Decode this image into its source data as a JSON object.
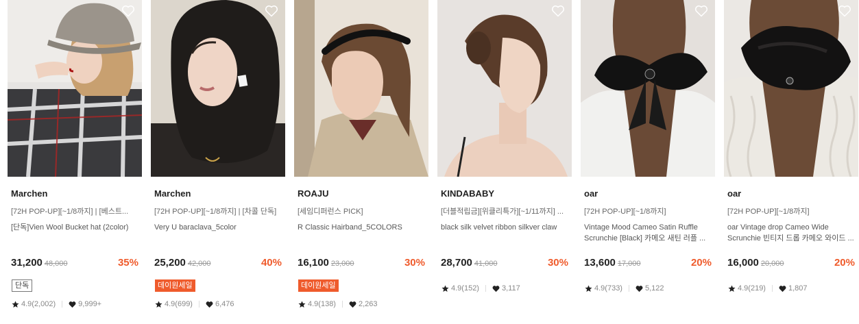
{
  "products": [
    {
      "brand": "Marchen",
      "line1": "[72H POP-UP][~1/8까지] | [베스트...",
      "desc": "[단독]Vien Wool Bucket hat (2color)",
      "price": "31,200",
      "original_price": "48,000",
      "discount": "35%",
      "badge": "단독",
      "badge_style": "outline",
      "rating": "4.9(2,002)",
      "likes": "9,999+",
      "heart_icon": "heart-outline-icon"
    },
    {
      "brand": "Marchen",
      "line1": "[72H POP-UP][~1/8까지] | [차콜 단독]",
      "desc": "Very U baraclava_5color",
      "price": "25,200",
      "original_price": "42,000",
      "discount": "40%",
      "badge": "데이원세일",
      "badge_style": "solid",
      "rating": "4.9(699)",
      "likes": "6,476",
      "heart_icon": "heart-outline-icon"
    },
    {
      "brand": "ROAJU",
      "line1": "[세임디퍼런스 PICK]",
      "desc": "R Classic Hairband_5COLORS",
      "price": "16,100",
      "original_price": "23,000",
      "discount": "30%",
      "badge": "데이원세일",
      "badge_style": "solid",
      "rating": "4.9(138)",
      "likes": "2,263",
      "heart_icon": "heart-outline-icon"
    },
    {
      "brand": "KINDABABY",
      "line1": "[더블적립금][위클리특가][~1/11까지] ...",
      "desc": "black silk velvet ribbon silkver claw",
      "price": "28,700",
      "original_price": "41,000",
      "discount": "30%",
      "badge": "",
      "badge_style": "none",
      "rating": "4.9(152)",
      "likes": "3,117",
      "heart_icon": "heart-outline-icon"
    },
    {
      "brand": "oar",
      "line1": "[72H POP-UP][~1/8까지]",
      "desc": "Vintage Mood Cameo Satin Ruffle Scrunchie [Black] 카메오 새틴 러플 ...",
      "price": "13,600",
      "original_price": "17,000",
      "discount": "20%",
      "badge": "",
      "badge_style": "none",
      "rating": "4.9(733)",
      "likes": "5,122",
      "heart_icon": "heart-outline-icon"
    },
    {
      "brand": "oar",
      "line1": "[72H POP-UP][~1/8까지]",
      "desc": "oar Vintage drop Cameo Wide Scrunchie 빈티지 드롭 카메오 와이드 ...",
      "price": "16,000",
      "original_price": "20,000",
      "discount": "20%",
      "badge": "",
      "badge_style": "none",
      "rating": "4.9(219)",
      "likes": "1,807",
      "heart_icon": "heart-outline-icon"
    }
  ],
  "colors": {
    "accent": "#ef5b2c",
    "text": "#222222",
    "muted": "#999999"
  }
}
